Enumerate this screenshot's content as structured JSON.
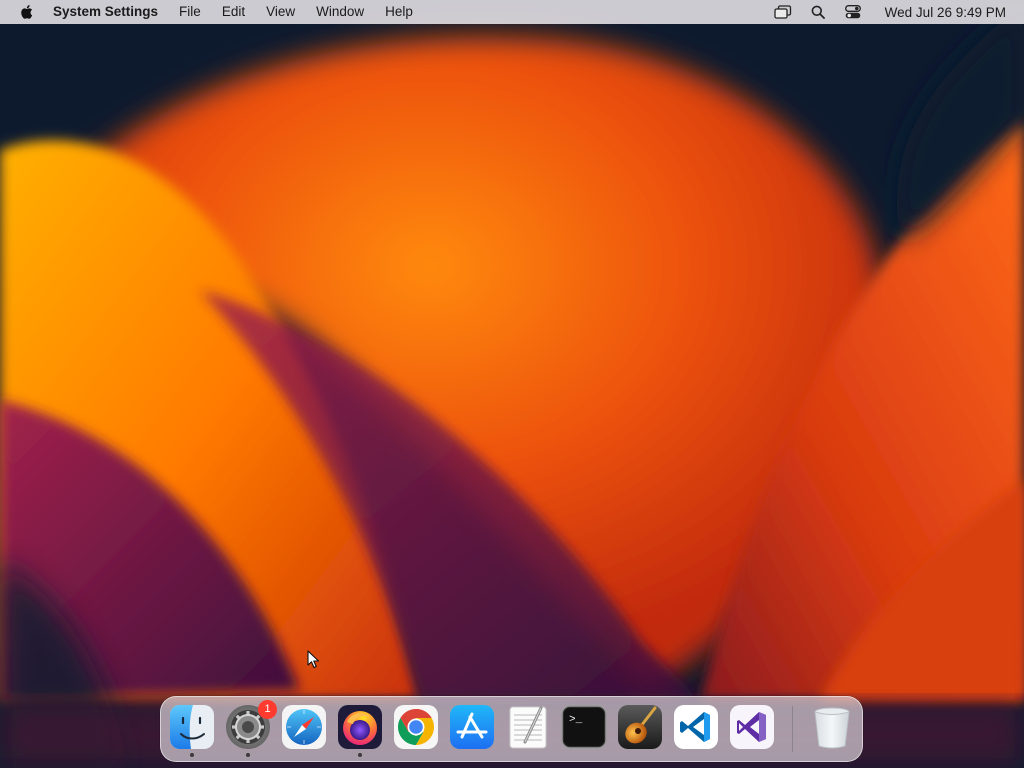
{
  "menubar": {
    "app_name": "System Settings",
    "menus": [
      "File",
      "Edit",
      "View",
      "Window",
      "Help"
    ],
    "clock": "Wed Jul 26  9:49 PM",
    "status_icons": [
      "window-stack-icon",
      "search-icon",
      "control-center-icon"
    ]
  },
  "dock": {
    "items": [
      {
        "name": "Finder",
        "icon": "finder-icon",
        "running": true
      },
      {
        "name": "System Settings",
        "icon": "system-settings-icon",
        "running": true,
        "badge": "1"
      },
      {
        "name": "Safari",
        "icon": "safari-icon",
        "running": false
      },
      {
        "name": "Firefox",
        "icon": "firefox-icon",
        "running": true
      },
      {
        "name": "Google Chrome",
        "icon": "chrome-icon",
        "running": false
      },
      {
        "name": "App Store",
        "icon": "app-store-icon",
        "running": false
      },
      {
        "name": "TextEdit",
        "icon": "textedit-icon",
        "running": false
      },
      {
        "name": "Terminal",
        "icon": "terminal-icon",
        "running": false
      },
      {
        "name": "GarageBand",
        "icon": "garageband-icon",
        "running": false
      },
      {
        "name": "Visual Studio Code",
        "icon": "vscode-icon",
        "running": false
      },
      {
        "name": "Visual Studio",
        "icon": "visual-studio-icon",
        "running": false
      },
      {
        "name": "Trash",
        "icon": "trash-icon",
        "running": false
      }
    ],
    "terminal_prompt": ">_"
  },
  "colors": {
    "wallpaper_orange": "#ff7a00",
    "wallpaper_red": "#d42a0c",
    "wallpaper_purple": "#6b1646",
    "wallpaper_navy": "#0d1a2e",
    "badge": "#ff3b30"
  }
}
